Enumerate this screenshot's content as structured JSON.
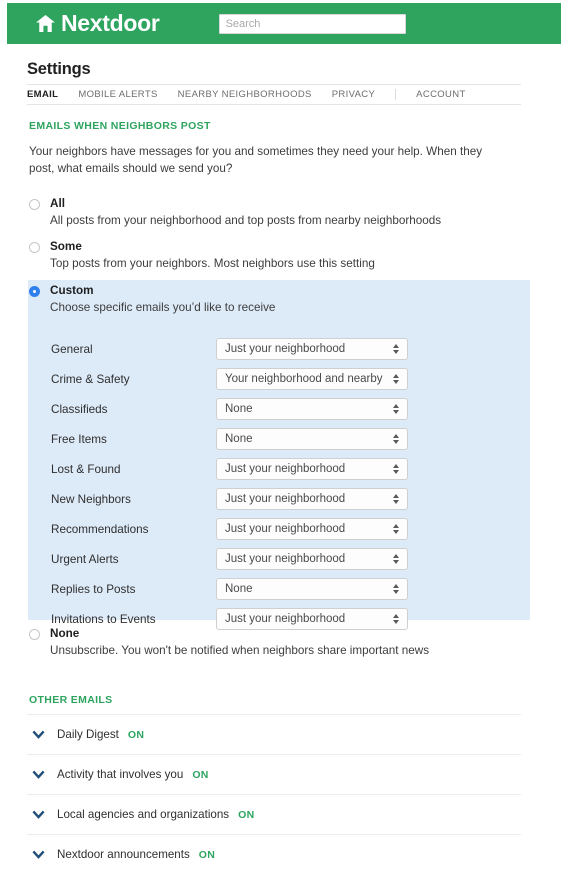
{
  "header": {
    "logo_icon": "house-icon",
    "brand": "Nextdoor",
    "search_placeholder": "Search",
    "search_value": "",
    "bg_color": "#2ea45f"
  },
  "page_title": "Settings",
  "tabs": [
    {
      "label": "EMAIL",
      "active": true
    },
    {
      "label": "MOBILE ALERTS",
      "active": false
    },
    {
      "label": "NEARBY NEIGHBORHOODS",
      "active": false
    },
    {
      "label": "PRIVACY",
      "active": false
    },
    {
      "label": "ACCOUNT",
      "active": false
    }
  ],
  "emails_section": {
    "heading": "EMAILS WHEN NEIGHBORS POST",
    "intro": "Your neighbors have messages for you and sometimes they need your help. When they post, what emails should we send you?",
    "options": {
      "all": {
        "title": "All",
        "desc": "All posts from your neighborhood and top posts from nearby neighborhoods",
        "selected": false
      },
      "some": {
        "title": "Some",
        "desc": "Top posts from your neighbors. Most neighbors use this setting",
        "selected": false
      },
      "custom": {
        "title": "Custom",
        "desc": "Choose specific emails you’d like to receive",
        "selected": true
      },
      "none": {
        "title": "None",
        "desc": "Unsubscribe. You won't be notified when neighbors share important news",
        "selected": false
      }
    },
    "preferences": [
      {
        "label": "General",
        "value": "Just your neighborhood"
      },
      {
        "label": "Crime & Safety",
        "value": "Your neighborhood and nearby"
      },
      {
        "label": "Classifieds",
        "value": "None"
      },
      {
        "label": "Free Items",
        "value": "None"
      },
      {
        "label": "Lost & Found",
        "value": "Just your neighborhood"
      },
      {
        "label": "New Neighbors",
        "value": "Just your neighborhood"
      },
      {
        "label": "Recommendations",
        "value": "Just your neighborhood"
      },
      {
        "label": "Urgent Alerts",
        "value": "Just your neighborhood"
      },
      {
        "label": "Replies to Posts",
        "value": "None"
      },
      {
        "label": "Invitations to Events",
        "value": "Just your neighborhood"
      }
    ]
  },
  "other_emails": {
    "heading": "OTHER EMAILS",
    "rows": [
      {
        "label": "Daily Digest",
        "state": "ON"
      },
      {
        "label": "Activity that involves you",
        "state": "ON"
      },
      {
        "label": "Local agencies and organizations",
        "state": "ON"
      },
      {
        "label": "Nextdoor announcements",
        "state": "ON"
      }
    ]
  },
  "colors": {
    "brand_green": "#2ea45f",
    "selected_blue": "#2f7fec",
    "panel_blue": "#ddeaf8",
    "chevron_navy": "#1f4e79"
  }
}
